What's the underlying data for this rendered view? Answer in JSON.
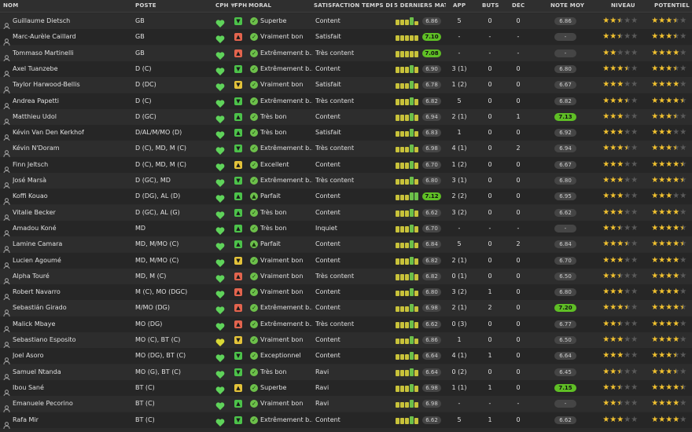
{
  "headers": {
    "nom": "NOM",
    "poste": "POSTE",
    "cph": "CPH",
    "fph": "FPH",
    "moral": "MORAL",
    "satisfaction": "SATISFACTION TEMPS DE JEU",
    "derniers": "5 DERNIERS MAT...",
    "app": "APP",
    "buts": "BUTS",
    "dec": "DÉC",
    "note": "NOTE MOY",
    "niveau": "NIVEAU",
    "potentiel": "POTENTIEL"
  },
  "colors": {
    "heart_green": "#5fd35a",
    "heart_yellow": "#d8d836",
    "fph_green": "#4cc24a",
    "fph_red": "#e3644e",
    "fph_yellow": "#e3c23a",
    "bar_green": "#6cc04a",
    "bar_yellow": "#c8c23a",
    "star_gold": "#f2c230",
    "star_empty": "#5a5a5a"
  },
  "players": [
    {
      "name": "Guillaume Dietsch",
      "pos": "GB",
      "cph": "green",
      "fph": "green-down",
      "moral": "Superbe",
      "moral_icon": "check",
      "sat": "Content",
      "form": [
        3,
        3,
        3,
        4,
        2
      ],
      "note_last": "6.86",
      "note_last_green": false,
      "app": "5",
      "buts": "0",
      "dec": "0",
      "avg": "6.86",
      "avg_green": false,
      "niveau": 2.5,
      "potentiel": 3.5
    },
    {
      "name": "Marc-Aurèle Caillard",
      "pos": "GB",
      "cph": "green",
      "fph": "red-up",
      "moral": "Vraiment bon",
      "moral_icon": "check",
      "sat": "Satisfait",
      "form": [
        3,
        3,
        3,
        3,
        3
      ],
      "note_last": "7.10",
      "note_last_green": true,
      "app": "-",
      "buts": "-",
      "dec": "-",
      "avg": "-",
      "avg_green": false,
      "niveau": 2.5,
      "potentiel": 3.5
    },
    {
      "name": "Tommaso Martinelli",
      "pos": "GB",
      "cph": "green",
      "fph": "red-up",
      "moral": "Extrêmement b...",
      "moral_icon": "check",
      "sat": "Très content",
      "form": [
        3,
        3,
        3,
        3,
        3
      ],
      "note_last": "7.08",
      "note_last_green": true,
      "app": "-",
      "buts": "-",
      "dec": "-",
      "avg": "-",
      "avg_green": false,
      "niveau": 2,
      "potentiel": 4
    },
    {
      "name": "Axel Tuanzebe",
      "pos": "D (C)",
      "cph": "green",
      "fph": "green-down",
      "moral": "Extrêmement b...",
      "moral_icon": "check",
      "sat": "Content",
      "form": [
        3,
        3,
        3,
        4,
        3
      ],
      "note_last": "6.90",
      "note_last_green": false,
      "app": "3 (1)",
      "buts": "0",
      "dec": "0",
      "avg": "6.80",
      "avg_green": false,
      "niveau": 3.5,
      "potentiel": 3.5
    },
    {
      "name": "Taylor Harwood-Bellis",
      "pos": "D (DC)",
      "cph": "green",
      "fph": "yellow-down",
      "moral": "Vraiment bon",
      "moral_icon": "check",
      "sat": "Satisfait",
      "form": [
        3,
        3,
        3,
        4,
        3
      ],
      "note_last": "6.78",
      "note_last_green": false,
      "app": "1 (2)",
      "buts": "0",
      "dec": "0",
      "avg": "6.67",
      "avg_green": false,
      "niveau": 3,
      "potentiel": 4
    },
    {
      "name": "Andrea Papetti",
      "pos": "D (C)",
      "cph": "green",
      "fph": "green-down",
      "moral": "Extrêmement b...",
      "moral_icon": "check",
      "sat": "Très content",
      "form": [
        3,
        3,
        3,
        4,
        3
      ],
      "note_last": "6.82",
      "note_last_green": false,
      "app": "5",
      "buts": "0",
      "dec": "0",
      "avg": "6.82",
      "avg_green": false,
      "niveau": 3.5,
      "potentiel": 4.5
    },
    {
      "name": "Matthieu Udol",
      "pos": "D (GC)",
      "cph": "green",
      "fph": "green-up",
      "moral": "Très bon",
      "moral_icon": "check",
      "sat": "Content",
      "form": [
        3,
        3,
        3,
        4,
        3
      ],
      "note_last": "6.94",
      "note_last_green": false,
      "app": "2 (1)",
      "buts": "0",
      "dec": "1",
      "avg": "7.13",
      "avg_green": true,
      "niveau": 3,
      "potentiel": 3.5
    },
    {
      "name": "Kévin Van Den Kerkhof",
      "pos": "D/AL/M/MO (D)",
      "cph": "green",
      "fph": "green-up",
      "moral": "Très bon",
      "moral_icon": "check",
      "sat": "Satisfait",
      "form": [
        3,
        3,
        3,
        4,
        3
      ],
      "note_last": "6.83",
      "note_last_green": false,
      "app": "1",
      "buts": "0",
      "dec": "0",
      "avg": "6.92",
      "avg_green": false,
      "niveau": 3,
      "potentiel": 3
    },
    {
      "name": "Kévin N'Doram",
      "pos": "D (C), MD, M (C)",
      "cph": "green",
      "fph": "green-down",
      "moral": "Extrêmement b...",
      "moral_icon": "check",
      "sat": "Très content",
      "form": [
        3,
        3,
        3,
        4,
        3
      ],
      "note_last": "6.98",
      "note_last_green": false,
      "app": "4 (1)",
      "buts": "0",
      "dec": "2",
      "avg": "6.94",
      "avg_green": false,
      "niveau": 3.5,
      "potentiel": 3.5
    },
    {
      "name": "Finn Jeltsch",
      "pos": "D (C), MD, M (C)",
      "cph": "green",
      "fph": "yellow-up",
      "moral": "Excellent",
      "moral_icon": "check",
      "sat": "Content",
      "form": [
        3,
        3,
        3,
        4,
        3
      ],
      "note_last": "6.70",
      "note_last_green": false,
      "app": "1 (2)",
      "buts": "0",
      "dec": "0",
      "avg": "6.67",
      "avg_green": false,
      "niveau": 3,
      "potentiel": 4.5
    },
    {
      "name": "José Marsà",
      "pos": "D (GC), MD",
      "cph": "green",
      "fph": "green-down",
      "moral": "Extrêmement b...",
      "moral_icon": "check",
      "sat": "Très content",
      "form": [
        3,
        3,
        3,
        4,
        3
      ],
      "note_last": "6.80",
      "note_last_green": false,
      "app": "3 (1)",
      "buts": "0",
      "dec": "0",
      "avg": "6.80",
      "avg_green": false,
      "niveau": 3,
      "potentiel": 4.5
    },
    {
      "name": "Koffi Kouao",
      "pos": "D (DG), AL (D)",
      "cph": "green",
      "fph": "green-up",
      "moral": "Parfait",
      "moral_icon": "up",
      "sat": "Content",
      "form": [
        3,
        3,
        3,
        4,
        4
      ],
      "note_last": "7.12",
      "note_last_green": true,
      "app": "2 (2)",
      "buts": "0",
      "dec": "0",
      "avg": "6.95",
      "avg_green": false,
      "niveau": 3,
      "potentiel": 3
    },
    {
      "name": "Vitalie Becker",
      "pos": "D (GC), AL (G)",
      "cph": "green",
      "fph": "green-up",
      "moral": "Très bon",
      "moral_icon": "check",
      "sat": "Content",
      "form": [
        3,
        3,
        3,
        4,
        3
      ],
      "note_last": "6.62",
      "note_last_green": false,
      "app": "3 (2)",
      "buts": "0",
      "dec": "0",
      "avg": "6.62",
      "avg_green": false,
      "niveau": 3,
      "potentiel": 4
    },
    {
      "name": "Amadou Koné",
      "pos": "MD",
      "cph": "green",
      "fph": "green-up",
      "moral": "Très bon",
      "moral_icon": "check",
      "sat": "Inquiet",
      "form": [
        3,
        3,
        3,
        4,
        3
      ],
      "note_last": "6.70",
      "note_last_green": false,
      "app": "-",
      "buts": "-",
      "dec": "-",
      "avg": "-",
      "avg_green": false,
      "niveau": 2.5,
      "potentiel": 4.5
    },
    {
      "name": "Lamine Camara",
      "pos": "MD, M/MO (C)",
      "cph": "green",
      "fph": "green-up",
      "moral": "Parfait",
      "moral_icon": "up",
      "sat": "Content",
      "form": [
        3,
        3,
        3,
        4,
        3
      ],
      "note_last": "6.84",
      "note_last_green": false,
      "app": "5",
      "buts": "0",
      "dec": "2",
      "avg": "6.84",
      "avg_green": false,
      "niveau": 3.5,
      "potentiel": 4.5
    },
    {
      "name": "Lucien Agoumé",
      "pos": "MD, M/MO (C)",
      "cph": "green",
      "fph": "yellow-down",
      "moral": "Vraiment bon",
      "moral_icon": "check",
      "sat": "Content",
      "form": [
        3,
        3,
        3,
        4,
        3
      ],
      "note_last": "6.82",
      "note_last_green": false,
      "app": "2 (1)",
      "buts": "0",
      "dec": "0",
      "avg": "6.70",
      "avg_green": false,
      "niveau": 3,
      "potentiel": 4
    },
    {
      "name": "Alpha Touré",
      "pos": "MD, M (C)",
      "cph": "green",
      "fph": "red-up",
      "moral": "Vraiment bon",
      "moral_icon": "check",
      "sat": "Très content",
      "form": [
        3,
        3,
        3,
        4,
        3
      ],
      "note_last": "6.82",
      "note_last_green": false,
      "app": "0 (1)",
      "buts": "0",
      "dec": "0",
      "avg": "6.50",
      "avg_green": false,
      "niveau": 2.5,
      "potentiel": 4
    },
    {
      "name": "Robert Navarro",
      "pos": "M (C), MO (DGC)",
      "cph": "green",
      "fph": "red-up",
      "moral": "Vraiment bon",
      "moral_icon": "check",
      "sat": "Content",
      "form": [
        3,
        3,
        3,
        4,
        3
      ],
      "note_last": "6.80",
      "note_last_green": false,
      "app": "3 (2)",
      "buts": "1",
      "dec": "0",
      "avg": "6.80",
      "avg_green": false,
      "niveau": 3,
      "potentiel": 4
    },
    {
      "name": "Sebastián Girado",
      "pos": "M/MO (DG)",
      "cph": "green",
      "fph": "red-up",
      "moral": "Extrêmement b...",
      "moral_icon": "check",
      "sat": "Content",
      "form": [
        3,
        3,
        3,
        4,
        3
      ],
      "note_last": "6.98",
      "note_last_green": false,
      "app": "2 (1)",
      "buts": "2",
      "dec": "0",
      "avg": "7.20",
      "avg_green": true,
      "niveau": 3.5,
      "potentiel": 4.5
    },
    {
      "name": "Malick Mbaye",
      "pos": "MO (DG)",
      "cph": "green",
      "fph": "red-up",
      "moral": "Extrêmement b...",
      "moral_icon": "check",
      "sat": "Très content",
      "form": [
        3,
        3,
        3,
        4,
        3
      ],
      "note_last": "6.62",
      "note_last_green": false,
      "app": "0 (3)",
      "buts": "0",
      "dec": "0",
      "avg": "6.77",
      "avg_green": false,
      "niveau": 2.5,
      "potentiel": 4
    },
    {
      "name": "Sebastiano Esposito",
      "pos": "MO (C), BT (C)",
      "cph": "yellow",
      "fph": "yellow-down",
      "moral": "Vraiment bon",
      "moral_icon": "check",
      "sat": "Content",
      "form": [
        3,
        3,
        3,
        4,
        3
      ],
      "note_last": "6.86",
      "note_last_green": false,
      "app": "1",
      "buts": "0",
      "dec": "0",
      "avg": "6.50",
      "avg_green": false,
      "niveau": 3,
      "potentiel": 4
    },
    {
      "name": "Joel Asoro",
      "pos": "MO (DG), BT (C)",
      "cph": "green",
      "fph": "green-down",
      "moral": "Exceptionnel",
      "moral_icon": "check",
      "sat": "Content",
      "form": [
        3,
        3,
        3,
        4,
        3
      ],
      "note_last": "6.64",
      "note_last_green": false,
      "app": "4 (1)",
      "buts": "1",
      "dec": "0",
      "avg": "6.64",
      "avg_green": false,
      "niveau": 3,
      "potentiel": 3.5
    },
    {
      "name": "Samuel Ntanda",
      "pos": "MO (G), BT (C)",
      "cph": "green",
      "fph": "green-down",
      "moral": "Très bon",
      "moral_icon": "check",
      "sat": "Ravi",
      "form": [
        3,
        3,
        3,
        4,
        3
      ],
      "note_last": "6.64",
      "note_last_green": false,
      "app": "0 (2)",
      "buts": "0",
      "dec": "0",
      "avg": "6.45",
      "avg_green": false,
      "niveau": 2.5,
      "potentiel": 3.5
    },
    {
      "name": "Ibou Sané",
      "pos": "BT (C)",
      "cph": "green",
      "fph": "yellow-up",
      "moral": "Superbe",
      "moral_icon": "check",
      "sat": "Ravi",
      "form": [
        3,
        3,
        3,
        4,
        3
      ],
      "note_last": "6.98",
      "note_last_green": false,
      "app": "1 (1)",
      "buts": "1",
      "dec": "0",
      "avg": "7.15",
      "avg_green": true,
      "niveau": 2.5,
      "potentiel": 4.5
    },
    {
      "name": "Emanuele Pecorino",
      "pos": "BT (C)",
      "cph": "green",
      "fph": "green-up",
      "moral": "Vraiment bon",
      "moral_icon": "check",
      "sat": "Ravi",
      "form": [
        3,
        3,
        3,
        4,
        3
      ],
      "note_last": "6.98",
      "note_last_green": false,
      "app": "-",
      "buts": "-",
      "dec": "-",
      "avg": "-",
      "avg_green": false,
      "niveau": 2.5,
      "potentiel": 4
    },
    {
      "name": "Rafa Mir",
      "pos": "BT (C)",
      "cph": "green",
      "fph": "green-down",
      "moral": "Extrêmement b...",
      "moral_icon": "check",
      "sat": "Content",
      "form": [
        3,
        3,
        3,
        4,
        3
      ],
      "note_last": "6.62",
      "note_last_green": false,
      "app": "5",
      "buts": "1",
      "dec": "0",
      "avg": "6.62",
      "avg_green": false,
      "niveau": 3,
      "potentiel": 4
    }
  ]
}
